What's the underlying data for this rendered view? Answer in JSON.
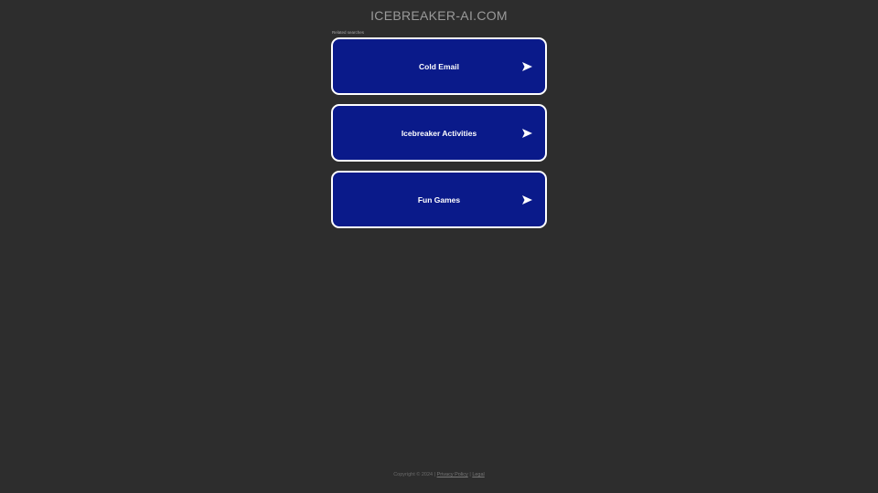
{
  "header": {
    "domain": "ICEBREAKER-AI.COM"
  },
  "related": {
    "label": "Related searches",
    "items": [
      {
        "label": "Cold Email"
      },
      {
        "label": "Icebreaker Activities"
      },
      {
        "label": "Fun Games"
      }
    ]
  },
  "footer": {
    "copyright": "Copyright © 2024 |",
    "privacy_label": "Privacy Policy",
    "separator": "|",
    "legal_label": "Legal"
  },
  "colors": {
    "background": "#2d2d2d",
    "card_fill": "#0a1a8a",
    "card_border": "#ffffff"
  },
  "icons": {
    "result_arrow": "arrow-right-icon"
  }
}
